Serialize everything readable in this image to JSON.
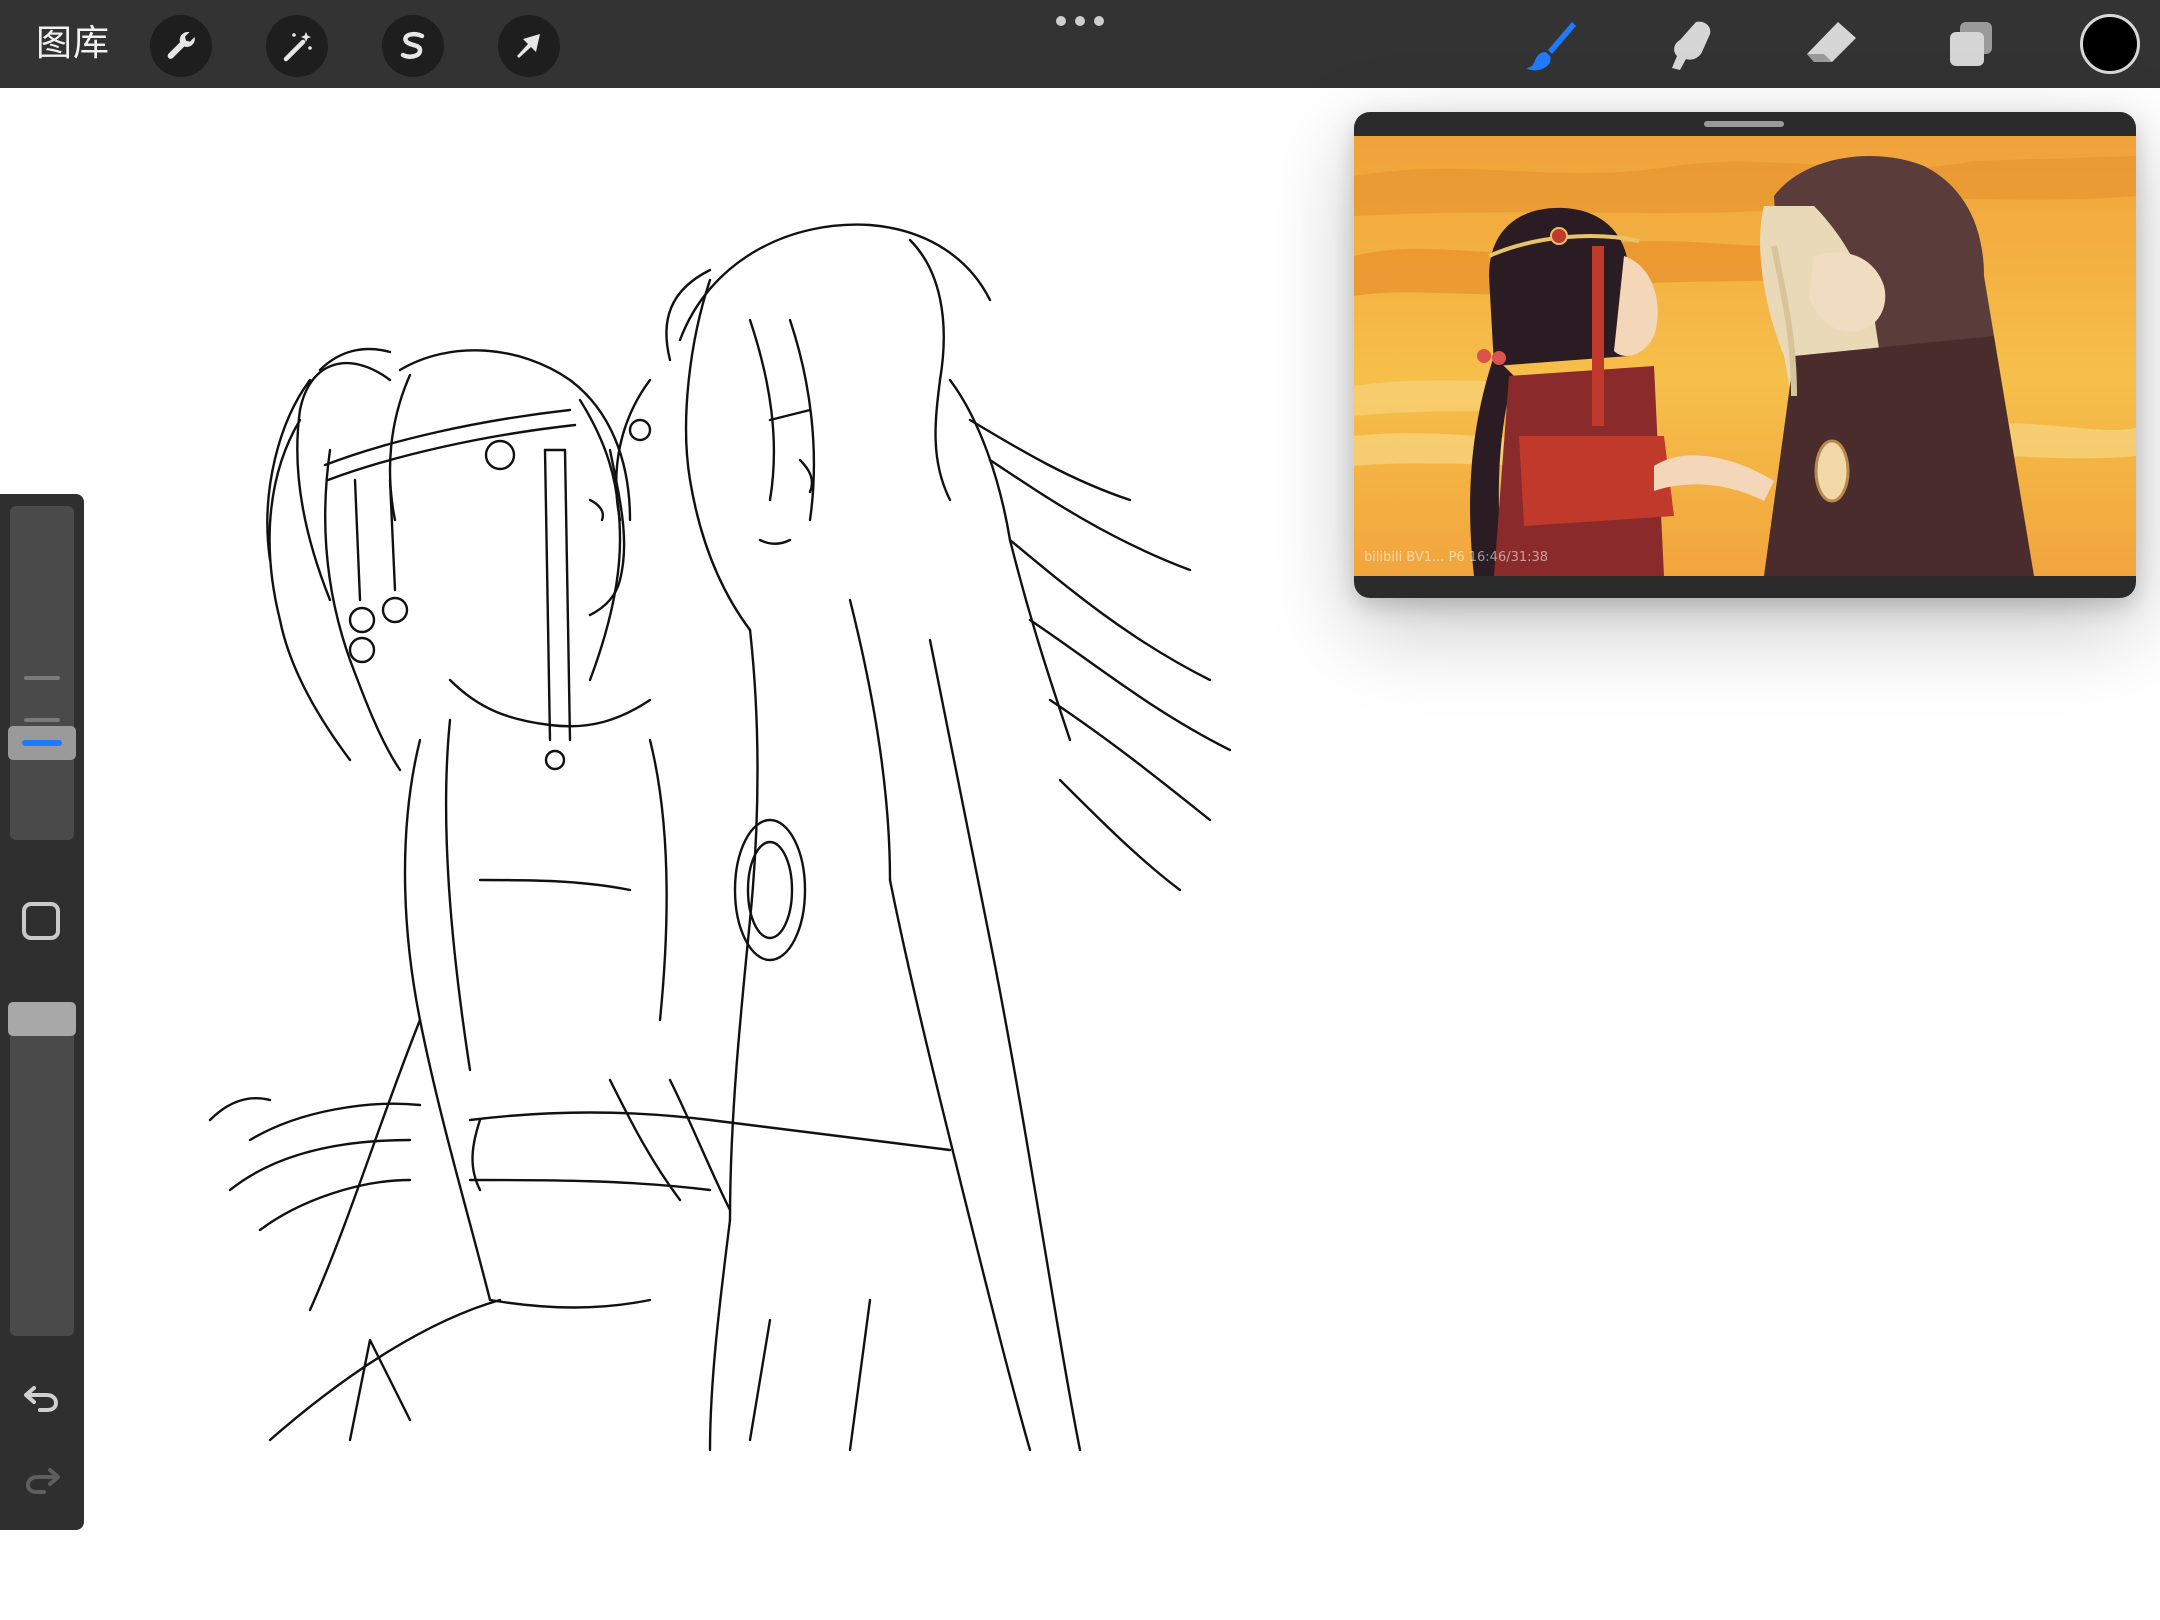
{
  "toolbar": {
    "gallery_label": "图库",
    "left_tools": [
      {
        "name": "actions",
        "icon": "wrench-icon"
      },
      {
        "name": "adjustments",
        "icon": "magic-wand-icon"
      },
      {
        "name": "selection",
        "icon": "selection-s-icon"
      },
      {
        "name": "transform",
        "icon": "arrow-cursor-icon"
      }
    ],
    "right_tools": [
      {
        "name": "paint",
        "icon": "brush-icon",
        "active": true
      },
      {
        "name": "smudge",
        "icon": "smudge-finger-icon",
        "active": false
      },
      {
        "name": "erase",
        "icon": "eraser-icon",
        "active": false
      },
      {
        "name": "layers",
        "icon": "layers-icon",
        "active": false
      }
    ],
    "current_color": "#000000",
    "accent_color": "#1f7aff"
  },
  "sidebar": {
    "brush_size_level": 0.72,
    "opacity_level": 1.0,
    "undo_icon": "undo-arrow-icon",
    "redo_icon": "redo-arrow-icon"
  },
  "reference": {
    "watermark": "bilibili BV1... P6 16:46/31:38"
  }
}
